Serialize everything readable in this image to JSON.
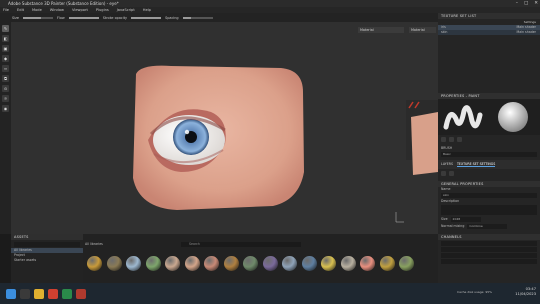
{
  "window": {
    "title": "Adobe Substance 3D Painter (Substance Edition) - eye*"
  },
  "menu": [
    "File",
    "Edit",
    "Mode",
    "Window",
    "Viewport",
    "Plugins",
    "JavaScript",
    "Help"
  ],
  "toolbar": {
    "size_label": "Size",
    "flow_label": "Flow",
    "stroke_label": "Stroke opacity",
    "spacing_label": "Spacing"
  },
  "viewport": {
    "dropdown1": "Material",
    "dropdown2": "Material"
  },
  "texture_set_list": {
    "title": "TEXTURE SET LIST",
    "settings": "Settings",
    "items": [
      {
        "name": "iris",
        "shader": "Main shader"
      },
      {
        "name": "skin",
        "shader": "Main shader"
      }
    ]
  },
  "properties": {
    "title": "PROPERTIES - PAINT",
    "brush_label": "BRUSH",
    "brush_value": "Basic",
    "tabs": [
      "LAYERS",
      "TEXTURE SET SETTINGS"
    ],
    "section": "GENERAL PROPERTIES",
    "rows": [
      "Name",
      "Description",
      "Size",
      "Normal mixing"
    ],
    "name_value": "skin",
    "size_value": "2048",
    "normal_value": "Combine",
    "channels_title": "CHANNELS"
  },
  "assets": {
    "title": "ASSETS",
    "search_placeholder": "Search",
    "library": "All libraries",
    "filters": [
      "All libraries",
      "Project",
      "Starter assets"
    ],
    "materials": [
      {
        "color": "#c89a3a"
      },
      {
        "color": "#8a7a55"
      },
      {
        "color": "#9db8d0"
      },
      {
        "color": "#7ea66c"
      },
      {
        "color": "#caa890"
      },
      {
        "color": "#d4a58a"
      },
      {
        "color": "#c98a76"
      },
      {
        "color": "#b08040"
      },
      {
        "color": "#6f8a6a"
      },
      {
        "color": "#7a6a9a"
      },
      {
        "color": "#8fa3b8"
      },
      {
        "color": "#5f7fa0"
      },
      {
        "color": "#d8c050"
      },
      {
        "color": "#b8b0a0"
      },
      {
        "color": "#e88f7f"
      },
      {
        "color": "#c0a040"
      },
      {
        "color": "#88a060"
      }
    ]
  },
  "taskbar": {
    "time": "03:47",
    "date": "11/04/2023",
    "status": "Cache disk usage: 95%"
  }
}
